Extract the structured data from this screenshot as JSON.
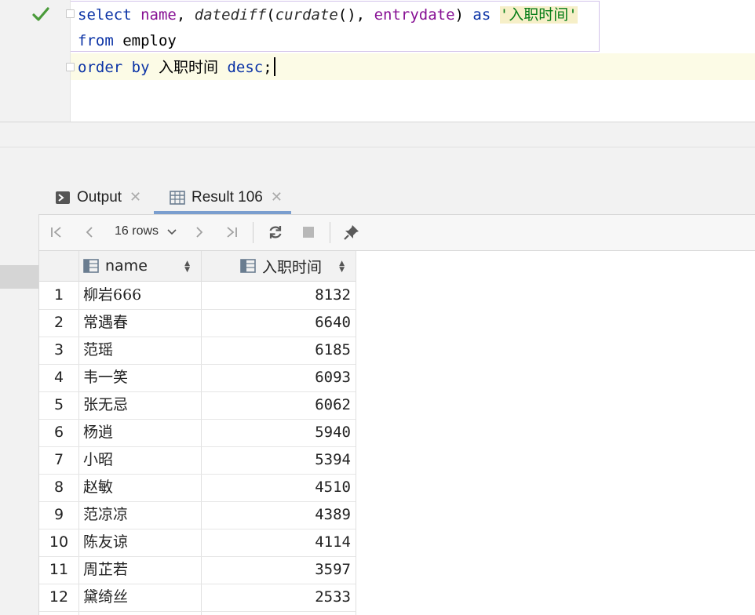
{
  "editor": {
    "lines": [
      {
        "kw1": "select",
        "col1": "name",
        "fn": "datediff",
        "fn2": "curdate",
        "col2": "entrydate",
        "kw2": "as",
        "alias": "'入职时间'"
      },
      {
        "kw": "from",
        "table": "employ"
      },
      {
        "kw1": "order",
        "kw2": "by",
        "field": "入职时间",
        "kw3": "desc",
        "end": ";"
      }
    ]
  },
  "tabs": [
    {
      "label": "Output",
      "icon": "console-icon"
    },
    {
      "label": "Result 106",
      "icon": "table-icon"
    }
  ],
  "toolbar": {
    "row_count": "16 rows"
  },
  "grid": {
    "columns": [
      "name",
      "入职时间"
    ],
    "rows": [
      {
        "num": "1",
        "name": "柳岩666",
        "value": "8132"
      },
      {
        "num": "2",
        "name": "常遇春",
        "value": "6640"
      },
      {
        "num": "3",
        "name": "范瑶",
        "value": "6185"
      },
      {
        "num": "4",
        "name": "韦一笑",
        "value": "6093"
      },
      {
        "num": "5",
        "name": "张无忌",
        "value": "6062"
      },
      {
        "num": "6",
        "name": "杨逍",
        "value": "5940"
      },
      {
        "num": "7",
        "name": "小昭",
        "value": "5394"
      },
      {
        "num": "8",
        "name": "赵敏",
        "value": "4510"
      },
      {
        "num": "9",
        "name": "范凉凉",
        "value": "4389"
      },
      {
        "num": "10",
        "name": "陈友谅",
        "value": "4114"
      },
      {
        "num": "11",
        "name": "周芷若",
        "value": "3597"
      },
      {
        "num": "12",
        "name": "黛绮丝",
        "value": "2533"
      }
    ]
  }
}
